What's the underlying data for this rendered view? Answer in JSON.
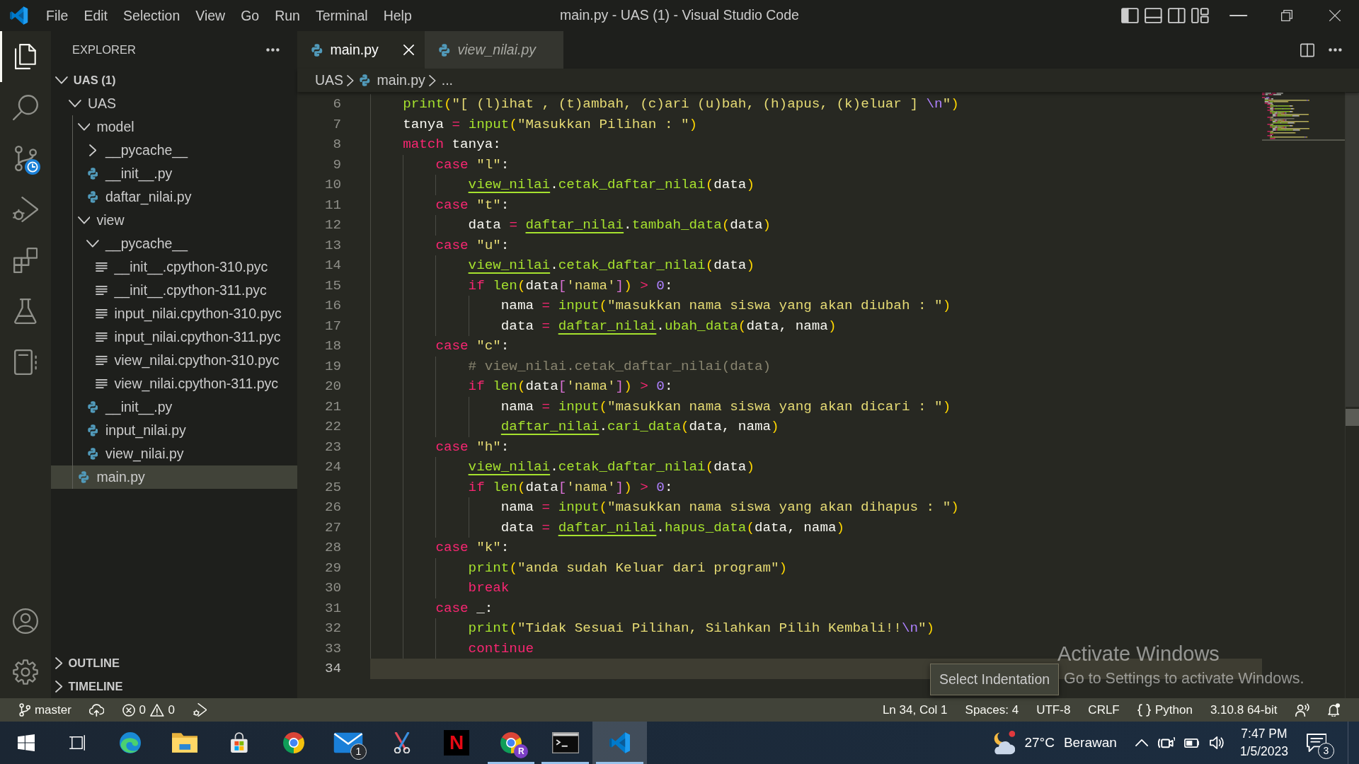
{
  "title_bar": {
    "menu": [
      "File",
      "Edit",
      "Selection",
      "View",
      "Go",
      "Run",
      "Terminal",
      "Help"
    ],
    "title": "main.py - UAS (1) - Visual Studio Code",
    "layout_toggles": [
      {
        "kind": "primary-sidebar",
        "on": true
      },
      {
        "kind": "panel",
        "on": false
      },
      {
        "kind": "secondary-sidebar",
        "on": false
      }
    ]
  },
  "activity_bar": {
    "items": [
      {
        "kind": "files",
        "selected": true,
        "clock_badge": false
      },
      {
        "kind": "search",
        "selected": false,
        "clock_badge": false
      },
      {
        "kind": "source-control",
        "selected": false,
        "clock_badge": true
      },
      {
        "kind": "run-debug",
        "selected": false,
        "clock_badge": false
      },
      {
        "kind": "extensions",
        "selected": false,
        "clock_badge": false
      },
      {
        "kind": "testing",
        "selected": false,
        "clock_badge": false
      },
      {
        "kind": "notebook",
        "selected": false,
        "clock_badge": false
      }
    ],
    "bottom": [
      {
        "kind": "account"
      },
      {
        "kind": "settings"
      }
    ]
  },
  "sidebar": {
    "title": "EXPLORER",
    "sections": [
      {
        "title": "UAS (1)",
        "expanded": true,
        "tree": [
          {
            "label": "UAS",
            "kind": "folder",
            "expanded": true,
            "selected": false,
            "children": [
              {
                "label": "model",
                "kind": "folder",
                "expanded": true,
                "selected": false,
                "children": [
                  {
                    "label": "__pycache__",
                    "kind": "folder",
                    "expanded": false,
                    "selected": false
                  },
                  {
                    "label": "__init__.py",
                    "kind": "python",
                    "selected": false
                  },
                  {
                    "label": "daftar_nilai.py",
                    "kind": "python",
                    "selected": false
                  }
                ]
              },
              {
                "label": "view",
                "kind": "folder",
                "expanded": true,
                "selected": false,
                "children": [
                  {
                    "label": "__pycache__",
                    "kind": "folder",
                    "expanded": true,
                    "selected": false,
                    "children": [
                      {
                        "label": "__init__.cpython-310.pyc",
                        "kind": "compiled",
                        "selected": false
                      },
                      {
                        "label": "__init__.cpython-311.pyc",
                        "kind": "compiled",
                        "selected": false
                      },
                      {
                        "label": "input_nilai.cpython-310.pyc",
                        "kind": "compiled",
                        "selected": false
                      },
                      {
                        "label": "input_nilai.cpython-311.pyc",
                        "kind": "compiled",
                        "selected": false
                      },
                      {
                        "label": "view_nilai.cpython-310.pyc",
                        "kind": "compiled",
                        "selected": false
                      },
                      {
                        "label": "view_nilai.cpython-311.pyc",
                        "kind": "compiled",
                        "selected": false
                      }
                    ]
                  },
                  {
                    "label": "__init__.py",
                    "kind": "python",
                    "selected": false
                  },
                  {
                    "label": "input_nilai.py",
                    "kind": "python",
                    "selected": false
                  },
                  {
                    "label": "view_nilai.py",
                    "kind": "python",
                    "selected": false
                  }
                ]
              },
              {
                "label": "main.py",
                "kind": "python",
                "selected": true
              }
            ]
          }
        ]
      },
      {
        "title": "OUTLINE",
        "expanded": false
      },
      {
        "title": "TIMELINE",
        "expanded": false
      }
    ]
  },
  "editor": {
    "tabs": [
      {
        "label": "main.py",
        "selected": true,
        "preview": false
      },
      {
        "label": "view_nilai.py",
        "selected": false,
        "preview": true
      }
    ],
    "breadcrumb": [
      {
        "kind": "folder",
        "label": "UAS"
      },
      {
        "kind": "python",
        "label": "main.py"
      },
      {
        "kind": "symbol",
        "label": "..."
      }
    ],
    "lines": [
      {
        "number": "6",
        "current": false,
        "tokens": [
          {
            "kind": "function",
            "text": "print"
          },
          {
            "kind": "bracket",
            "text": "("
          },
          {
            "kind": "string",
            "text": "\"[ (l)ihat , (t)ambah, (c)ari (u)bah, (h)apus, (k)eluar ] "
          },
          {
            "kind": "escape",
            "text": "\\n"
          },
          {
            "kind": "string",
            "text": "\""
          },
          {
            "kind": "bracket",
            "text": ")"
          }
        ]
      },
      {
        "number": "7",
        "current": false,
        "tokens": [
          {
            "kind": "plain",
            "text": "tanya "
          },
          {
            "kind": "operator",
            "text": "= "
          },
          {
            "kind": "function",
            "text": "input"
          },
          {
            "kind": "bracket",
            "text": "("
          },
          {
            "kind": "string",
            "text": "\"Masukkan Pilihan : \""
          },
          {
            "kind": "bracket",
            "text": ")"
          }
        ]
      },
      {
        "number": "8",
        "current": false,
        "tokens": [
          {
            "kind": "keyword",
            "text": "match"
          },
          {
            "kind": "plain",
            "text": " tanya:"
          }
        ],
        "children": [
          {
            "number": "9",
            "current": false,
            "tokens": [
              {
                "kind": "keyword",
                "text": "case "
              },
              {
                "kind": "string",
                "text": "\"l\""
              },
              {
                "kind": "plain",
                "text": ":"
              }
            ],
            "children": [
              {
                "number": "10",
                "current": false,
                "tokens": [
                  {
                    "kind": "module",
                    "text": "view_nilai"
                  },
                  {
                    "kind": "plain",
                    "text": "."
                  },
                  {
                    "kind": "function",
                    "text": "cetak_daftar_nilai"
                  },
                  {
                    "kind": "bracket",
                    "text": "("
                  },
                  {
                    "kind": "plain",
                    "text": "data"
                  },
                  {
                    "kind": "bracket",
                    "text": ")"
                  }
                ]
              }
            ]
          },
          {
            "number": "11",
            "current": false,
            "tokens": [
              {
                "kind": "keyword",
                "text": "case "
              },
              {
                "kind": "string",
                "text": "\"t\""
              },
              {
                "kind": "plain",
                "text": ":"
              }
            ],
            "children": [
              {
                "number": "12",
                "current": false,
                "tokens": [
                  {
                    "kind": "plain",
                    "text": "data "
                  },
                  {
                    "kind": "operator",
                    "text": "= "
                  },
                  {
                    "kind": "module",
                    "text": "daftar_nilai"
                  },
                  {
                    "kind": "plain",
                    "text": "."
                  },
                  {
                    "kind": "function",
                    "text": "tambah_data"
                  },
                  {
                    "kind": "bracket",
                    "text": "("
                  },
                  {
                    "kind": "plain",
                    "text": "data"
                  },
                  {
                    "kind": "bracket",
                    "text": ")"
                  }
                ]
              }
            ]
          },
          {
            "number": "13",
            "current": false,
            "tokens": [
              {
                "kind": "keyword",
                "text": "case "
              },
              {
                "kind": "string",
                "text": "\"u\""
              },
              {
                "kind": "plain",
                "text": ":"
              }
            ],
            "children": [
              {
                "number": "14",
                "current": false,
                "tokens": [
                  {
                    "kind": "module",
                    "text": "view_nilai"
                  },
                  {
                    "kind": "plain",
                    "text": "."
                  },
                  {
                    "kind": "function",
                    "text": "cetak_daftar_nilai"
                  },
                  {
                    "kind": "bracket",
                    "text": "("
                  },
                  {
                    "kind": "plain",
                    "text": "data"
                  },
                  {
                    "kind": "bracket",
                    "text": ")"
                  }
                ]
              },
              {
                "number": "15",
                "current": false,
                "tokens": [
                  {
                    "kind": "keyword",
                    "text": "if "
                  },
                  {
                    "kind": "function",
                    "text": "len"
                  },
                  {
                    "kind": "bracket",
                    "text": "("
                  },
                  {
                    "kind": "plain",
                    "text": "data"
                  },
                  {
                    "kind": "bracket2",
                    "text": "["
                  },
                  {
                    "kind": "string",
                    "text": "'nama'"
                  },
                  {
                    "kind": "bracket2",
                    "text": "]"
                  },
                  {
                    "kind": "bracket",
                    "text": ") "
                  },
                  {
                    "kind": "operator",
                    "text": "> "
                  },
                  {
                    "kind": "number",
                    "text": "0"
                  },
                  {
                    "kind": "plain",
                    "text": ":"
                  }
                ],
                "children": [
                  {
                    "number": "16",
                    "current": false,
                    "tokens": [
                      {
                        "kind": "plain",
                        "text": "nama "
                      },
                      {
                        "kind": "operator",
                        "text": "= "
                      },
                      {
                        "kind": "function",
                        "text": "input"
                      },
                      {
                        "kind": "bracket",
                        "text": "("
                      },
                      {
                        "kind": "string",
                        "text": "\"masukkan nama siswa yang akan diubah : \""
                      },
                      {
                        "kind": "bracket",
                        "text": ")"
                      }
                    ]
                  },
                  {
                    "number": "17",
                    "current": false,
                    "tokens": [
                      {
                        "kind": "plain",
                        "text": "data "
                      },
                      {
                        "kind": "operator",
                        "text": "= "
                      },
                      {
                        "kind": "module",
                        "text": "daftar_nilai"
                      },
                      {
                        "kind": "plain",
                        "text": "."
                      },
                      {
                        "kind": "function",
                        "text": "ubah_data"
                      },
                      {
                        "kind": "bracket",
                        "text": "("
                      },
                      {
                        "kind": "plain",
                        "text": "data, nama"
                      },
                      {
                        "kind": "bracket",
                        "text": ")"
                      }
                    ]
                  }
                ]
              }
            ]
          },
          {
            "number": "18",
            "current": false,
            "tokens": [
              {
                "kind": "keyword",
                "text": "case "
              },
              {
                "kind": "string",
                "text": "\"c\""
              },
              {
                "kind": "plain",
                "text": ":"
              }
            ],
            "children": [
              {
                "number": "19",
                "current": false,
                "tokens": [
                  {
                    "kind": "comment",
                    "text": "# view_nilai.cetak_daftar_nilai(data)"
                  }
                ]
              },
              {
                "number": "20",
                "current": false,
                "tokens": [
                  {
                    "kind": "keyword",
                    "text": "if "
                  },
                  {
                    "kind": "function",
                    "text": "len"
                  },
                  {
                    "kind": "bracket",
                    "text": "("
                  },
                  {
                    "kind": "plain",
                    "text": "data"
                  },
                  {
                    "kind": "bracket2",
                    "text": "["
                  },
                  {
                    "kind": "string",
                    "text": "'nama'"
                  },
                  {
                    "kind": "bracket2",
                    "text": "]"
                  },
                  {
                    "kind": "bracket",
                    "text": ") "
                  },
                  {
                    "kind": "operator",
                    "text": "> "
                  },
                  {
                    "kind": "number",
                    "text": "0"
                  },
                  {
                    "kind": "plain",
                    "text": ":"
                  }
                ],
                "children": [
                  {
                    "number": "21",
                    "current": false,
                    "tokens": [
                      {
                        "kind": "plain",
                        "text": "nama "
                      },
                      {
                        "kind": "operator",
                        "text": "= "
                      },
                      {
                        "kind": "function",
                        "text": "input"
                      },
                      {
                        "kind": "bracket",
                        "text": "("
                      },
                      {
                        "kind": "string",
                        "text": "\"masukkan nama siswa yang akan dicari : \""
                      },
                      {
                        "kind": "bracket",
                        "text": ")"
                      }
                    ]
                  },
                  {
                    "number": "22",
                    "current": false,
                    "tokens": [
                      {
                        "kind": "module",
                        "text": "daftar_nilai"
                      },
                      {
                        "kind": "plain",
                        "text": "."
                      },
                      {
                        "kind": "function",
                        "text": "cari_data"
                      },
                      {
                        "kind": "bracket",
                        "text": "("
                      },
                      {
                        "kind": "plain",
                        "text": "data, nama"
                      },
                      {
                        "kind": "bracket",
                        "text": ")"
                      }
                    ]
                  }
                ]
              }
            ]
          },
          {
            "number": "23",
            "current": false,
            "tokens": [
              {
                "kind": "keyword",
                "text": "case "
              },
              {
                "kind": "string",
                "text": "\"h\""
              },
              {
                "kind": "plain",
                "text": ":"
              }
            ],
            "children": [
              {
                "number": "24",
                "current": false,
                "tokens": [
                  {
                    "kind": "module",
                    "text": "view_nilai"
                  },
                  {
                    "kind": "plain",
                    "text": "."
                  },
                  {
                    "kind": "function",
                    "text": "cetak_daftar_nilai"
                  },
                  {
                    "kind": "bracket",
                    "text": "("
                  },
                  {
                    "kind": "plain",
                    "text": "data"
                  },
                  {
                    "kind": "bracket",
                    "text": ")"
                  }
                ]
              },
              {
                "number": "25",
                "current": false,
                "tokens": [
                  {
                    "kind": "keyword",
                    "text": "if "
                  },
                  {
                    "kind": "function",
                    "text": "len"
                  },
                  {
                    "kind": "bracket",
                    "text": "("
                  },
                  {
                    "kind": "plain",
                    "text": "data"
                  },
                  {
                    "kind": "bracket2",
                    "text": "["
                  },
                  {
                    "kind": "string",
                    "text": "'nama'"
                  },
                  {
                    "kind": "bracket2",
                    "text": "]"
                  },
                  {
                    "kind": "bracket",
                    "text": ") "
                  },
                  {
                    "kind": "operator",
                    "text": "> "
                  },
                  {
                    "kind": "number",
                    "text": "0"
                  },
                  {
                    "kind": "plain",
                    "text": ":"
                  }
                ],
                "children": [
                  {
                    "number": "26",
                    "current": false,
                    "tokens": [
                      {
                        "kind": "plain",
                        "text": "nama "
                      },
                      {
                        "kind": "operator",
                        "text": "= "
                      },
                      {
                        "kind": "function",
                        "text": "input"
                      },
                      {
                        "kind": "bracket",
                        "text": "("
                      },
                      {
                        "kind": "string",
                        "text": "\"masukkan nama siswa yang akan dihapus : \""
                      },
                      {
                        "kind": "bracket",
                        "text": ")"
                      }
                    ]
                  },
                  {
                    "number": "27",
                    "current": false,
                    "tokens": [
                      {
                        "kind": "plain",
                        "text": "data "
                      },
                      {
                        "kind": "operator",
                        "text": "= "
                      },
                      {
                        "kind": "module",
                        "text": "daftar_nilai"
                      },
                      {
                        "kind": "plain",
                        "text": "."
                      },
                      {
                        "kind": "function",
                        "text": "hapus_data"
                      },
                      {
                        "kind": "bracket",
                        "text": "("
                      },
                      {
                        "kind": "plain",
                        "text": "data, nama"
                      },
                      {
                        "kind": "bracket",
                        "text": ")"
                      }
                    ]
                  }
                ]
              }
            ]
          },
          {
            "number": "28",
            "current": false,
            "tokens": [
              {
                "kind": "keyword",
                "text": "case "
              },
              {
                "kind": "string",
                "text": "\"k\""
              },
              {
                "kind": "plain",
                "text": ":"
              }
            ],
            "children": [
              {
                "number": "29",
                "current": false,
                "tokens": [
                  {
                    "kind": "function",
                    "text": "print"
                  },
                  {
                    "kind": "bracket",
                    "text": "("
                  },
                  {
                    "kind": "string",
                    "text": "\"anda sudah Keluar dari program\""
                  },
                  {
                    "kind": "bracket",
                    "text": ")"
                  }
                ]
              },
              {
                "number": "30",
                "current": false,
                "tokens": [
                  {
                    "kind": "keyword",
                    "text": "break"
                  }
                ]
              }
            ]
          },
          {
            "number": "31",
            "current": false,
            "tokens": [
              {
                "kind": "keyword",
                "text": "case "
              },
              {
                "kind": "plain",
                "text": "_:"
              }
            ],
            "children": [
              {
                "number": "32",
                "current": false,
                "tokens": [
                  {
                    "kind": "function",
                    "text": "print"
                  },
                  {
                    "kind": "bracket",
                    "text": "("
                  },
                  {
                    "kind": "string",
                    "text": "\"Tidak Sesuai Pilihan, Silahkan Pilih Kembali!!"
                  },
                  {
                    "kind": "escape",
                    "text": "\\n"
                  },
                  {
                    "kind": "string",
                    "text": "\""
                  },
                  {
                    "kind": "bracket",
                    "text": ")"
                  }
                ]
              },
              {
                "number": "33",
                "current": false,
                "tokens": [
                  {
                    "kind": "keyword",
                    "text": "continue"
                  }
                ]
              }
            ]
          }
        ]
      },
      {
        "number": "34",
        "current": true
      }
    ]
  },
  "status_bar": {
    "branch": "master",
    "errors": "0",
    "warnings": "0",
    "items": [
      {
        "kind": "text",
        "text": "Ln 34, Col 1"
      },
      {
        "kind": "text",
        "text": "Spaces: 4"
      },
      {
        "kind": "text",
        "text": "UTF-8"
      },
      {
        "kind": "text",
        "text": "CRLF"
      },
      {
        "kind": "language",
        "text": "Python"
      },
      {
        "kind": "text",
        "text": "3.10.8 64-bit"
      }
    ]
  },
  "tooltip": {
    "text": "Select Indentation"
  },
  "activation_notice": {
    "title": "Activate Windows",
    "message": "Go to Settings to activate Windows."
  },
  "taskbar": {
    "apps": [
      {
        "kind": "wave-browser",
        "running": false,
        "active": false
      },
      {
        "kind": "folder",
        "running": false,
        "active": false
      },
      {
        "kind": "store",
        "running": false,
        "active": false
      },
      {
        "kind": "ring-browser",
        "running": false,
        "active": false
      },
      {
        "kind": "mail",
        "badge": "1",
        "running": false,
        "active": false
      },
      {
        "kind": "snip",
        "running": false,
        "active": false
      },
      {
        "kind": "letter-tile",
        "glyph": "N",
        "running": false,
        "active": false
      },
      {
        "kind": "ring-browser",
        "profile": "R",
        "running": true,
        "active": false
      },
      {
        "kind": "terminal",
        "running": true,
        "active": false
      },
      {
        "kind": "code-editor",
        "running": true,
        "active": true
      }
    ],
    "weather": {
      "temperature": "27°C",
      "condition": "Berawan"
    },
    "time": "7:47 PM",
    "date": "1/5/2023",
    "notifications": "3"
  }
}
